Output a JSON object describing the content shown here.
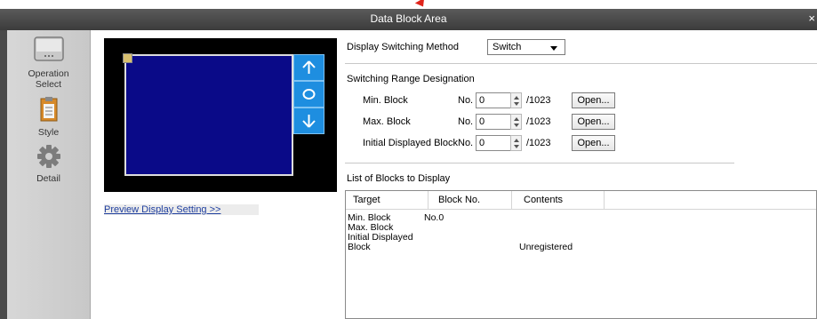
{
  "window": {
    "title": "Data Block Area",
    "close_glyph": "×"
  },
  "sidebar": {
    "items": [
      {
        "label_line1": "Operation",
        "label_line2": "Select",
        "icon": "keyboard-icon"
      },
      {
        "label": "Style",
        "icon": "clipboard-icon"
      },
      {
        "label": "Detail",
        "icon": "gear-icon"
      }
    ]
  },
  "preview": {
    "link": "Preview Display Setting >>"
  },
  "display": {
    "switching_label": "Display Switching Method",
    "switching_value": "Switch"
  },
  "range": {
    "heading": "Switching Range Designation",
    "rows": [
      {
        "label": "Min. Block",
        "no": "No.",
        "value": "0",
        "max": "/1023",
        "button": "Open..."
      },
      {
        "label": "Max. Block",
        "no": "No.",
        "value": "0",
        "max": "/1023",
        "button": "Open..."
      },
      {
        "label": "Initial Displayed Block",
        "no": "No.",
        "value": "0",
        "max": "/1023",
        "button": "Open..."
      }
    ]
  },
  "list": {
    "heading": "List of Blocks to Display",
    "columns": [
      "Target",
      "Block No.",
      "Contents"
    ],
    "rows": [
      {
        "target": "Min. Block",
        "block": "No.0",
        "contents": ""
      },
      {
        "target": "Max. Block",
        "block": "",
        "contents": ""
      },
      {
        "target": "Initial Displayed",
        "block": "",
        "contents": ""
      },
      {
        "target": "Block",
        "block": "",
        "contents": "Unregistered"
      }
    ]
  }
}
